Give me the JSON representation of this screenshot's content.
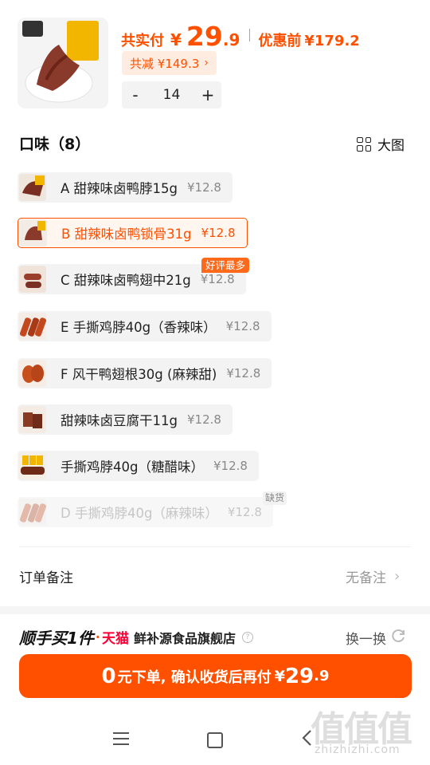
{
  "product": {
    "pay_label": "共实付",
    "currency": "¥",
    "pay_int": "29",
    "pay_dec": ".9",
    "orig_label": "优惠前",
    "orig_price": "¥179.2",
    "saving": "共减 ¥149.3",
    "quantity": "14",
    "minus": "-",
    "plus": "+"
  },
  "flavors": {
    "title": "口味（8）",
    "big_view": "大图",
    "hot_tag": "好评最多",
    "out_tag": "缺货",
    "options": [
      {
        "label": "A 甜辣味卤鸭脖15g",
        "price": "¥12.8"
      },
      {
        "label": "B 甜辣味卤鸭锁骨31g",
        "price": "¥12.8"
      },
      {
        "label": "C 甜辣味卤鸭翅中21g",
        "price": "¥12.8"
      },
      {
        "label": "E 手撕鸡脖40g（香辣味）",
        "price": "¥12.8"
      },
      {
        "label": "F 风干鸭翅根30g (麻辣甜)",
        "price": "¥12.8"
      },
      {
        "label": "甜辣味卤豆腐干11g",
        "price": "¥12.8"
      },
      {
        "label": "手撕鸡脖40g（糖醋味）",
        "price": "¥12.8"
      },
      {
        "label": "D 手撕鸡脖40g（麻辣味）",
        "price": "¥12.8"
      }
    ]
  },
  "note": {
    "label": "订单备注",
    "value": "无备注"
  },
  "promo": {
    "title": "顺手买1件",
    "dot": "·",
    "tmall": "天猫",
    "store": "鲜补源食品旗舰店",
    "swap": "换一换"
  },
  "cta": {
    "zero": "0",
    "text": "元下单, 确认收货后再付",
    "yen": "¥",
    "int": "29",
    "dec": ".9"
  },
  "watermark": {
    "big": "值值值",
    "url": "zhizhizhi.com"
  },
  "colors": {
    "accent": "#ff5000",
    "tmall": "#ff0036"
  }
}
